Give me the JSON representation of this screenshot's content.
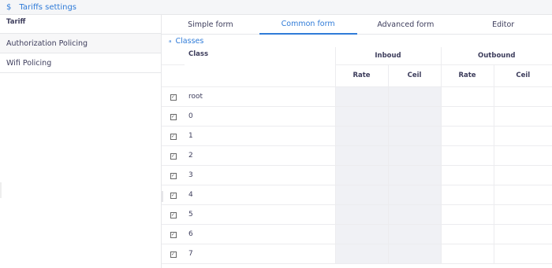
{
  "header": {
    "title": "Tariffs settings",
    "icon": "dollar-icon"
  },
  "sidebar": {
    "items": [
      {
        "label": "Tariff"
      },
      {
        "label": "Authorization Policing"
      },
      {
        "label": "Wifi Policing"
      }
    ]
  },
  "tabs": [
    {
      "label": "Simple form"
    },
    {
      "label": "Common form"
    },
    {
      "label": "Advanced form"
    },
    {
      "label": "Editor"
    }
  ],
  "active_tab": "Common form",
  "section": {
    "title": "Classes",
    "icon": "classes-icon"
  },
  "table": {
    "class_header": "Class",
    "inbound_header": "Inboud",
    "outbound_header": "Outbound",
    "rate_header": "Rate",
    "ceil_header": "Ceil",
    "rows": [
      "root",
      "0",
      "1",
      "2",
      "3",
      "4",
      "5",
      "6",
      "7"
    ]
  },
  "colors": {
    "accent": "#2f7bd8",
    "text": "#3d3d5c",
    "shade": "#f0f1f5"
  }
}
